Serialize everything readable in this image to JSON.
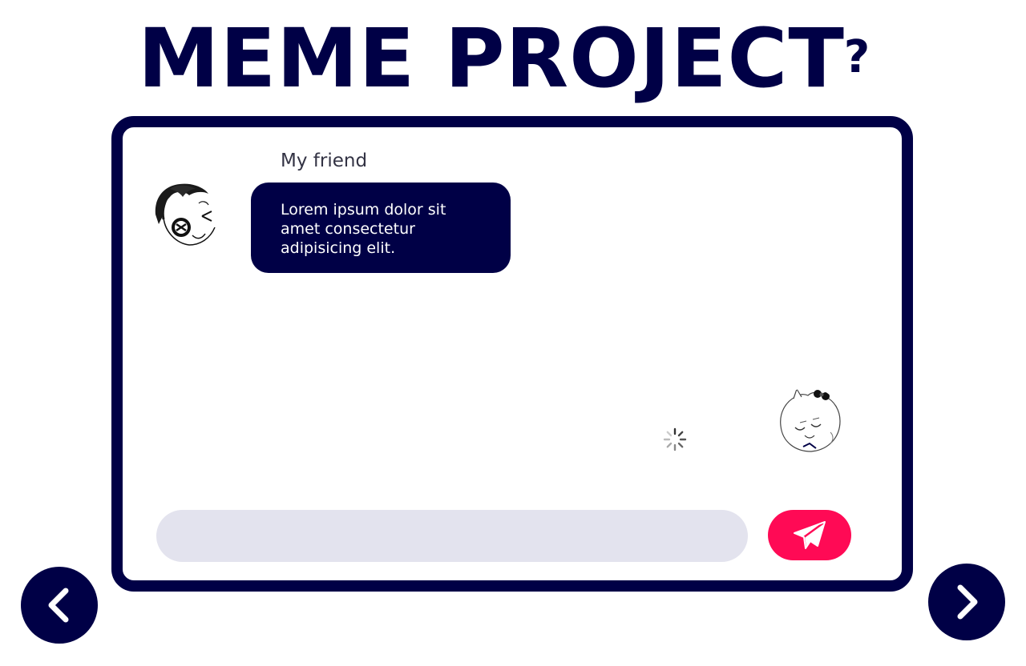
{
  "header": {
    "title": "MEME PROJECT",
    "help_label": "?"
  },
  "chat": {
    "friend_name": "My friend",
    "friend_message": "Lorem ipsum dolor sit amet consectetur adipisicing elit.",
    "status": "loading"
  },
  "composer": {
    "input_value": "",
    "input_placeholder": "",
    "send_icon": "paper-plane-icon"
  },
  "navigation": {
    "prev_icon": "chevron-left-icon",
    "next_icon": "chevron-right-icon"
  },
  "colors": {
    "navy": "#000046",
    "accent_pink": "#ff0a55",
    "input_gray": "#e3e3ee",
    "white": "#ffffff"
  }
}
